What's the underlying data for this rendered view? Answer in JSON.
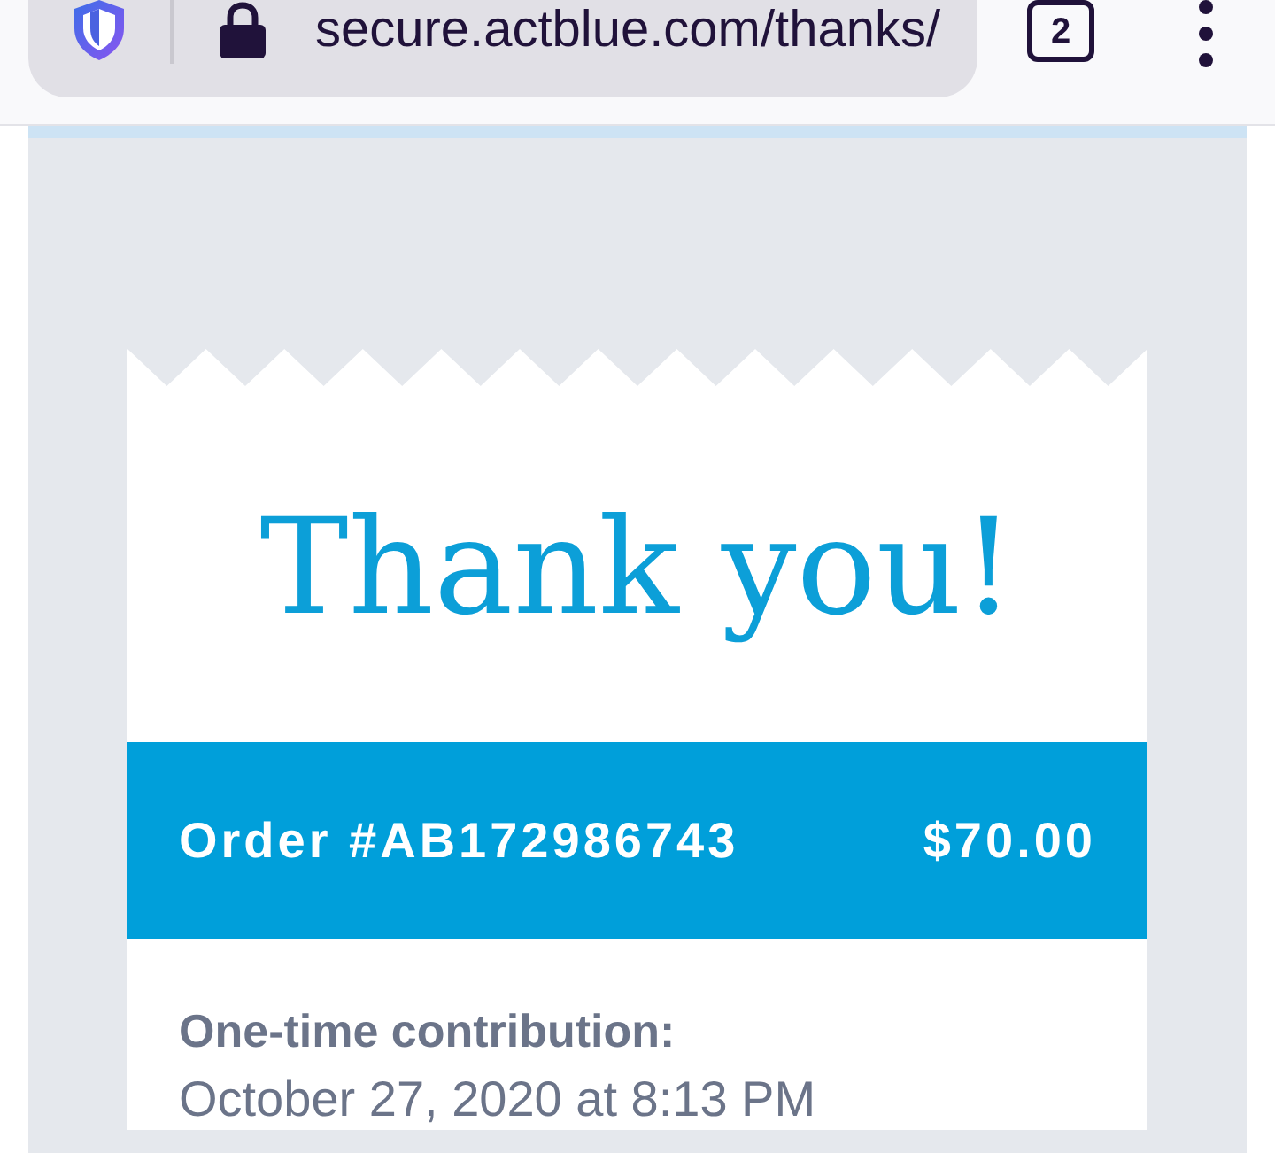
{
  "browser": {
    "url": "secure.actblue.com/thanks/",
    "tab_count": "2"
  },
  "receipt": {
    "title": "Thank you!",
    "order": "Order #AB172986743",
    "amount": "$70.00",
    "contribution_label": "One-time contribution:",
    "date": "October 27, 2020 at 8:13 PM"
  }
}
